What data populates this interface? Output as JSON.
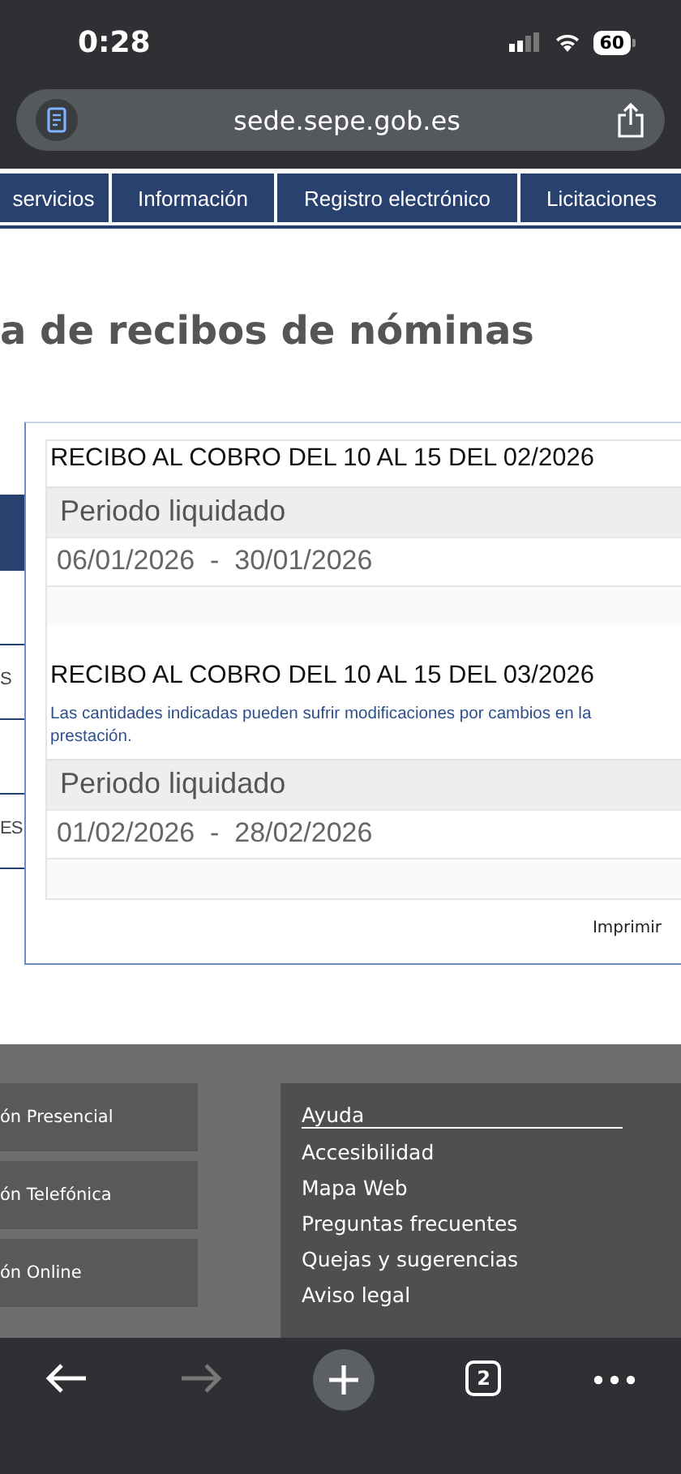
{
  "status_bar": {
    "time": "0:28",
    "battery": "60"
  },
  "address_bar": {
    "url": "sede.sepe.gob.es"
  },
  "nav_tabs": [
    {
      "label": "servicios"
    },
    {
      "label": "Información"
    },
    {
      "label": "Registro electrónico"
    },
    {
      "label": "Licitaciones"
    }
  ],
  "page_title": "a de recibos de nóminas",
  "sidebar": {
    "items": [
      {
        "selected": false
      },
      {
        "selected": true
      },
      {
        "selected": false
      },
      {
        "label": "S",
        "selected": false
      },
      {
        "selected": false
      },
      {
        "label": "ES",
        "selected": false
      }
    ]
  },
  "receipts": [
    {
      "title": "RECIBO AL COBRO DEL 10 AL 15 DEL 02/2026",
      "period_label": "Periodo liquidado",
      "period": "06/01/2026  -  30/01/2026"
    },
    {
      "title": "RECIBO AL COBRO DEL 10 AL 15 DEL 03/2026",
      "note_lines": [
        "Las cantidades indicadas pueden sufrir modificaciones por cambios en la",
        "prestación."
      ],
      "period_label": "Periodo liquidado",
      "period": "01/02/2026  -  28/02/2026"
    }
  ],
  "print_link": "Imprimir",
  "footer": {
    "contact_buttons": [
      "ón Presencial",
      "ón Telefónica",
      "ón Online"
    ],
    "help": {
      "title": "Ayuda",
      "links": [
        "Accesibilidad",
        "Mapa Web",
        "Preguntas frecuentes",
        "Quejas y sugerencias",
        "Aviso legal"
      ]
    }
  },
  "toolbar": {
    "back_enabled": true,
    "forward_enabled": false,
    "tab_count": "2"
  }
}
